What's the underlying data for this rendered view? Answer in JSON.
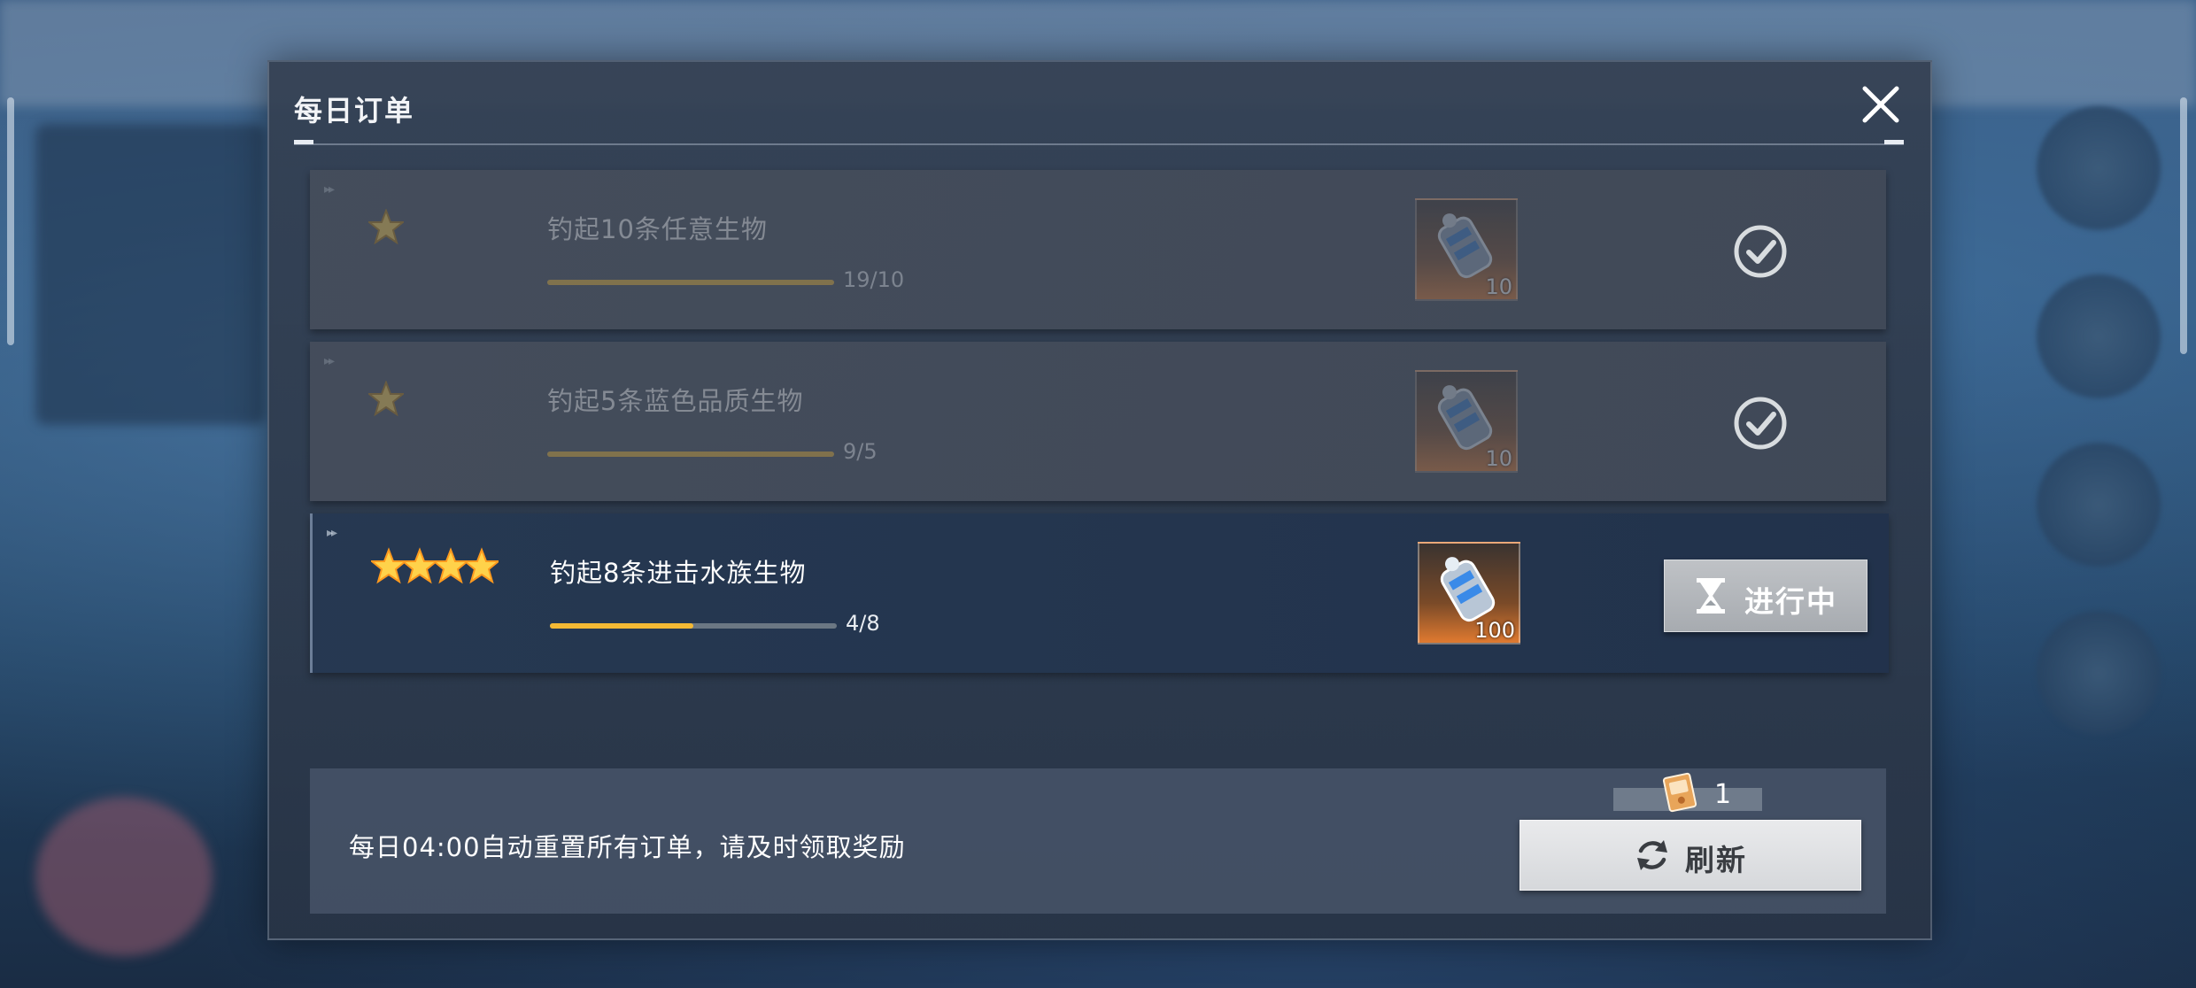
{
  "dialog": {
    "title": "每日订单"
  },
  "orders": [
    {
      "title": "钓起10条任意生物",
      "progress_text": "19/10",
      "progress_fraction": 1.0,
      "stars": 1,
      "reward_qty": "10",
      "status": "completed",
      "status_icon": "check-circle-icon"
    },
    {
      "title": "钓起5条蓝色品质生物",
      "progress_text": "9/5",
      "progress_fraction": 1.0,
      "stars": 1,
      "reward_qty": "10",
      "status": "completed",
      "status_icon": "check-circle-icon"
    },
    {
      "title": "钓起8条进击水族生物",
      "progress_text": "4/8",
      "progress_fraction": 0.5,
      "stars": 4,
      "reward_qty": "100",
      "status": "in-progress",
      "status_label": "进行中",
      "status_icon": "hourglass-icon"
    }
  ],
  "footer": {
    "note": "每日04:00自动重置所有订单，请及时领取奖励",
    "refresh_cost": "1",
    "refresh_label": "刷新"
  },
  "colors": {
    "progress_fill": "#f4b934",
    "star": "#ffd24a"
  }
}
